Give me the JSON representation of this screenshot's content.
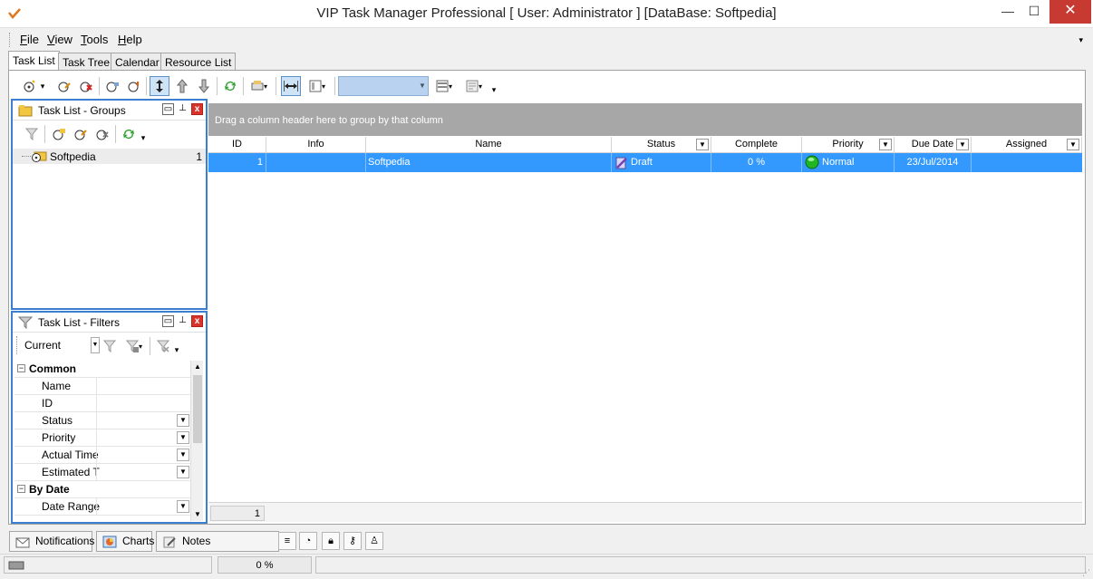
{
  "window": {
    "title": "VIP Task Manager Professional [ User: Administrator ] [DataBase: Softpedia]",
    "min_glyph": "—",
    "max_glyph": "☐",
    "close_glyph": "✕"
  },
  "menu": {
    "file": "ile",
    "file_key": "F",
    "view": "iew",
    "view_key": "V",
    "tools": "ools",
    "tools_key": "T",
    "help": "elp",
    "help_key": "H"
  },
  "tabs": [
    "Task List",
    "Task Tree",
    "Calendar",
    "Resource List"
  ],
  "groups_panel": {
    "title": "Task List - Groups",
    "tree_item": "Softpedia",
    "tree_count": "1"
  },
  "filters_panel": {
    "title": "Task List - Filters",
    "current": "Current",
    "categories": [
      {
        "label": "Common"
      },
      {
        "label": "By Date"
      }
    ],
    "rows": [
      "Name",
      "ID",
      "Status",
      "Priority",
      "Actual Time",
      "Estimated T",
      "Date Range"
    ]
  },
  "grid": {
    "group_hint": "Drag a column header here to group by that column",
    "columns": [
      "ID",
      "Info",
      "Name",
      "Status",
      "Complete",
      "Priority",
      "Due Date",
      "Assigned"
    ],
    "row": {
      "id": "1",
      "info": "",
      "name": "Softpedia",
      "status": "Draft",
      "complete": "0 %",
      "priority": "Normal",
      "due_date": "23/Jul/2014",
      "assigned": ""
    },
    "footer_count": "1"
  },
  "bottom_tabs": [
    "Notifications",
    "Charts",
    "Notes"
  ],
  "statusbar": {
    "progress": "0 %"
  },
  "colors": {
    "selection": "#3399ff",
    "panel_border": "#3a7fd0",
    "group_band": "#a7a7a7",
    "close_red": "#c73a31"
  }
}
